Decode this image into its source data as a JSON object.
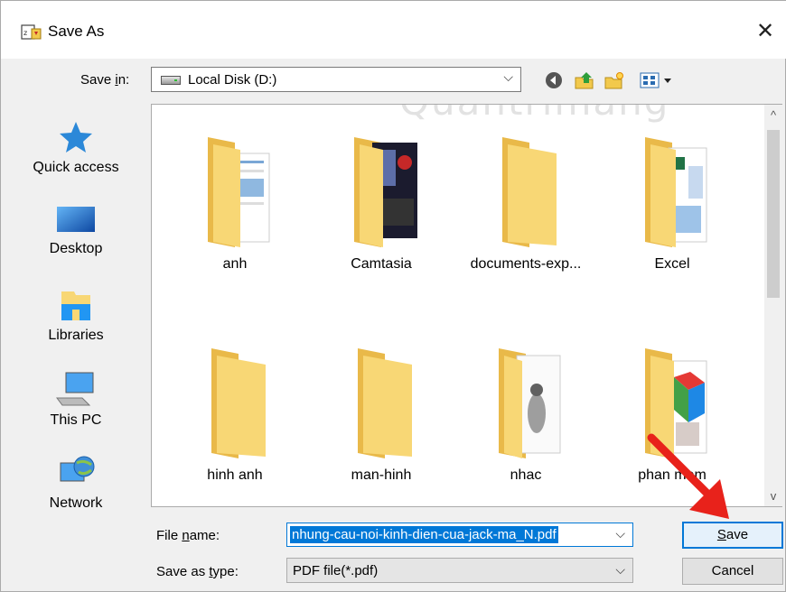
{
  "window": {
    "title": "Save As",
    "close_glyph": "✕"
  },
  "toolbar": {
    "save_in_label_pre": "Save ",
    "save_in_label_key": "i",
    "save_in_label_post": "n:",
    "location": "Local Disk (D:)",
    "icons": [
      "back-icon",
      "up-folder-icon",
      "new-folder-icon",
      "view-menu-icon"
    ]
  },
  "sidebar": {
    "items": [
      {
        "label": "Quick access",
        "icon": "star-icon"
      },
      {
        "label": "Desktop",
        "icon": "desktop-icon"
      },
      {
        "label": "Libraries",
        "icon": "libraries-icon"
      },
      {
        "label": "This PC",
        "icon": "computer-icon"
      },
      {
        "label": "Network",
        "icon": "network-icon"
      }
    ]
  },
  "files": {
    "folders": [
      {
        "name": "anh"
      },
      {
        "name": "Camtasia"
      },
      {
        "name": "documents-exp..."
      },
      {
        "name": "Excel"
      },
      {
        "name": "hinh anh"
      },
      {
        "name": "man-hinh"
      },
      {
        "name": "nhac"
      },
      {
        "name": "phan  mem"
      }
    ]
  },
  "watermark": "Quantrimang",
  "footer": {
    "file_name_label_pre": "File ",
    "file_name_label_key": "n",
    "file_name_label_post": "ame:",
    "file_name_value": "nhung-cau-noi-kinh-dien-cua-jack-ma_N.pdf",
    "save_type_label_pre": "Save as ",
    "save_type_label_key": "t",
    "save_type_label_post": "ype:",
    "save_type_value": "PDF file(*.pdf)",
    "save_key": "S",
    "save_rest": "ave",
    "cancel_label": "Cancel"
  },
  "colors": {
    "accent": "#0078d7",
    "folder": "#f8d775",
    "annotation_arrow": "#e8221b"
  }
}
